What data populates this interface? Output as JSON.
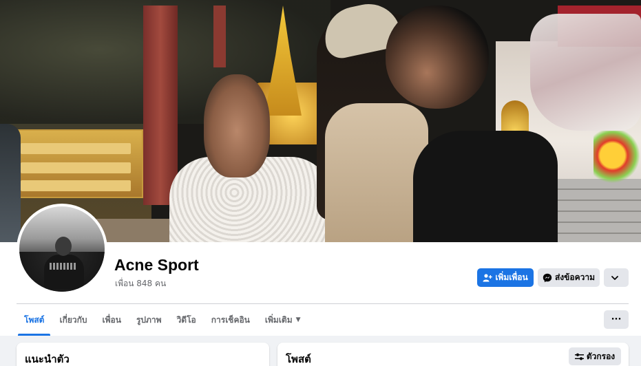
{
  "profile": {
    "name": "Acne Sport",
    "friends_text": "เพื่อน 848 คน"
  },
  "actions": {
    "add_friend_label": "เพิ่มเพื่อน",
    "message_label": "ส่งข้อความ",
    "more_icon": "chevron-down-icon"
  },
  "tabs": [
    {
      "label": "โพสต์",
      "active": true
    },
    {
      "label": "เกี่ยวกับ",
      "active": false
    },
    {
      "label": "เพื่อน",
      "active": false
    },
    {
      "label": "รูปภาพ",
      "active": false
    },
    {
      "label": "วิดีโอ",
      "active": false
    },
    {
      "label": "การเช็คอิน",
      "active": false
    },
    {
      "label": "เพิ่มเติม",
      "active": false
    }
  ],
  "tabs_more_label": "···",
  "intro_card": {
    "title": "แนะนำตัว"
  },
  "posts_card": {
    "title": "โพสต์",
    "filter_label": "ตัวกรอง"
  },
  "colors": {
    "accent": "#1b74e4",
    "background": "#f0f2f5",
    "button_gray": "#e4e6eb"
  }
}
